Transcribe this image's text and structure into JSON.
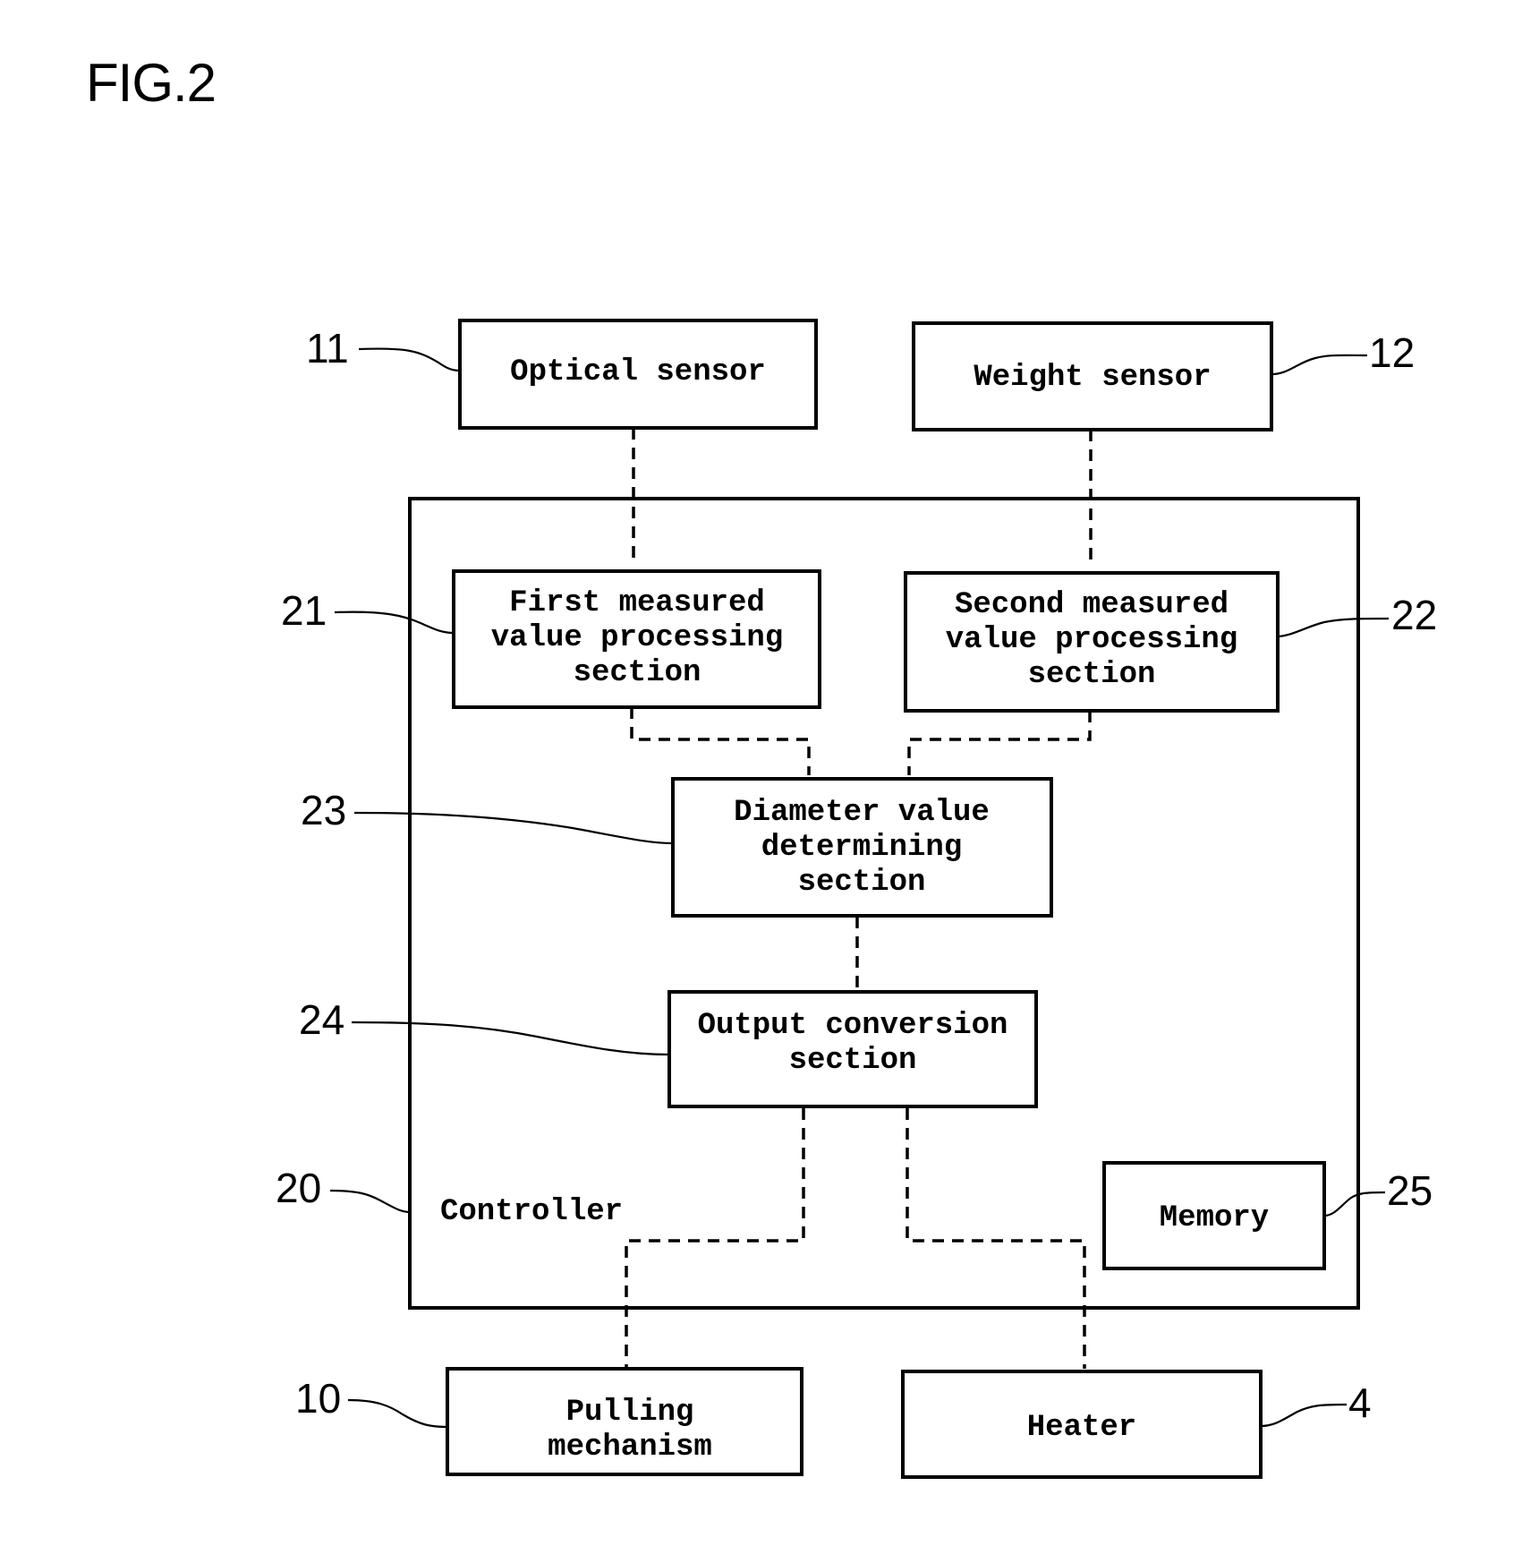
{
  "figure": {
    "title": "FIG.2",
    "blocks": {
      "optical_sensor": {
        "ref": "11",
        "lines": [
          "Optical sensor"
        ]
      },
      "weight_sensor": {
        "ref": "12",
        "lines": [
          "Weight sensor"
        ]
      },
      "controller": {
        "ref": "20",
        "lines": [
          "Controller"
        ]
      },
      "first_processing": {
        "ref": "21",
        "lines": [
          "First measured",
          "value processing",
          "section"
        ]
      },
      "second_processing": {
        "ref": "22",
        "lines": [
          "Second measured",
          "value processing",
          "section"
        ]
      },
      "diameter_determining": {
        "ref": "23",
        "lines": [
          "Diameter value",
          "determining",
          "section"
        ]
      },
      "output_conversion": {
        "ref": "24",
        "lines": [
          "Output conversion",
          "section"
        ]
      },
      "memory": {
        "ref": "25",
        "lines": [
          "Memory"
        ]
      },
      "pulling_mechanism": {
        "ref": "10",
        "lines": [
          "Pulling",
          "mechanism"
        ]
      },
      "heater": {
        "ref": "4",
        "lines": [
          "Heater"
        ]
      }
    },
    "connections": [
      {
        "from": "optical_sensor",
        "to": "first_processing",
        "style": "dashed"
      },
      {
        "from": "weight_sensor",
        "to": "second_processing",
        "style": "dashed"
      },
      {
        "from": "first_processing",
        "to": "diameter_determining",
        "style": "dashed"
      },
      {
        "from": "second_processing",
        "to": "diameter_determining",
        "style": "dashed"
      },
      {
        "from": "diameter_determining",
        "to": "output_conversion",
        "style": "dashed"
      },
      {
        "from": "output_conversion",
        "to": "pulling_mechanism",
        "style": "dashed"
      },
      {
        "from": "output_conversion",
        "to": "heater",
        "style": "dashed"
      }
    ]
  }
}
